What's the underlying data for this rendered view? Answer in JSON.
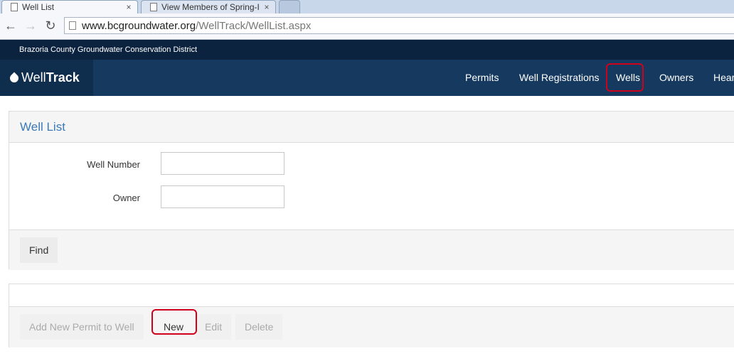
{
  "browser": {
    "tabs": [
      {
        "title": "Well List",
        "close": "×"
      },
      {
        "title": "View Members of Spring-I",
        "close": "×"
      }
    ],
    "url_domain": "www.bcgroundwater.org",
    "url_path": "/WellTrack/WellList.aspx"
  },
  "site": {
    "district": "Brazoria County Groundwater Conservation District",
    "brand_light": "Well",
    "brand_bold": "Track",
    "nav": [
      "Permits",
      "Well Registrations",
      "Wells",
      "Owners",
      "Hear"
    ]
  },
  "search_panel": {
    "title": "Well List",
    "well_number_label": "Well Number",
    "well_number_value": "",
    "owner_label": "Owner",
    "owner_value": "",
    "find_label": "Find"
  },
  "actions_panel": {
    "add_permit_label": "Add New Permit to Well",
    "new_label": "New",
    "edit_label": "Edit",
    "delete_label": "Delete"
  },
  "highlight_color": "#d0021b"
}
